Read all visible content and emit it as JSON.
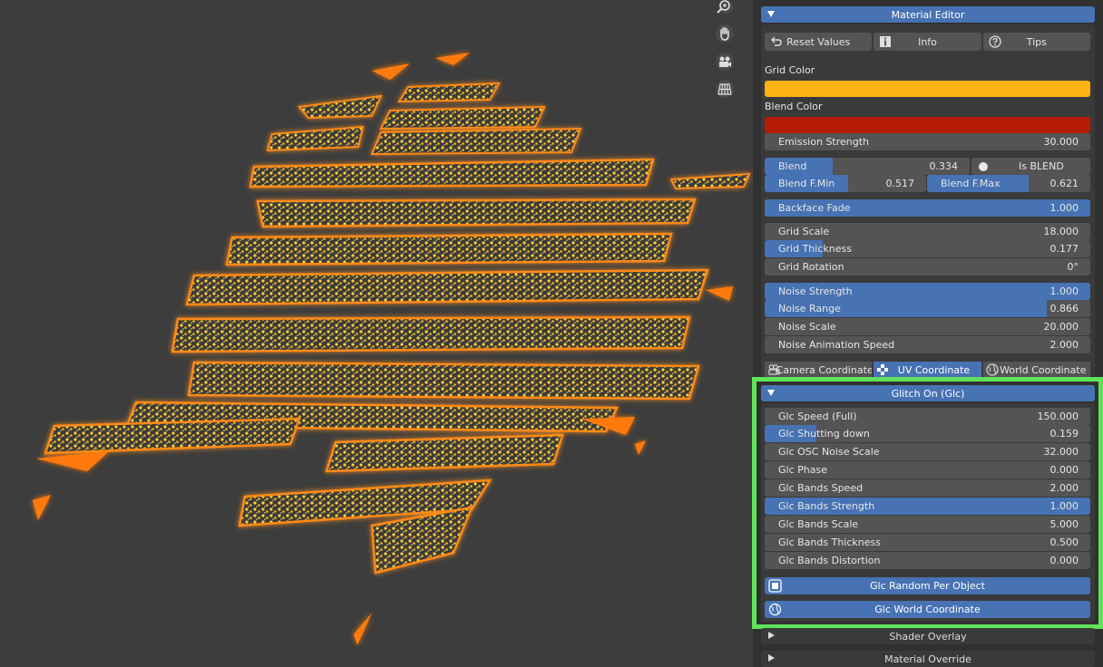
{
  "viewport_tools": [
    {
      "icon": "zoom-icon"
    },
    {
      "icon": "hand-pan-icon"
    },
    {
      "icon": "camera-icon"
    },
    {
      "icon": "grid-perspective-icon"
    }
  ],
  "material_editor": {
    "title": "Material Editor",
    "buttons": {
      "reset": "Reset Values",
      "info": "Info",
      "tips": "Tips"
    },
    "grid_color_label": "Grid Color",
    "grid_color": "#fdb213",
    "blend_color_label": "Blend Color",
    "blend_color": "#b51c06",
    "emission": {
      "name": "Emission Strength",
      "value": "30.000"
    },
    "blend": {
      "name": "Blend",
      "value": "0.334",
      "fraction": 0.334
    },
    "is_blend": "Is BLEND",
    "blend_fmin": {
      "name": "Blend F.Min",
      "value": "0.517",
      "fraction": 0.517
    },
    "blend_fmax": {
      "name": "Blend F.Max",
      "value": "0.621",
      "fraction": 0.621
    },
    "backface_fade": {
      "name": "Backface Fade",
      "value": "1.000",
      "fraction": 1.0
    },
    "grid_scale": {
      "name": "Grid Scale",
      "value": "18.000"
    },
    "grid_thickness": {
      "name": "Grid Thickness",
      "value": "0.177",
      "fraction": 0.177
    },
    "grid_rotation": {
      "name": "Grid Rotation",
      "value": "0°"
    },
    "noise_strength": {
      "name": "Noise Strength",
      "value": "1.000",
      "fraction": 1.0
    },
    "noise_range": {
      "name": "Noise Range",
      "value": "0.866",
      "fraction": 0.866
    },
    "noise_scale": {
      "name": "Noise Scale",
      "value": "20.000"
    },
    "noise_anim": {
      "name": "Noise Animation Speed",
      "value": "2.000"
    },
    "coord_tabs": {
      "camera": "Camera Coordinate",
      "uv": "UV Coordinate",
      "world": "World Coordinate"
    }
  },
  "glitch": {
    "title": "Glitch On (Glc)",
    "fields": [
      {
        "name": "Glc Speed (Full)",
        "value": "150.000",
        "fraction": 0
      },
      {
        "name": "Glc Shutting down",
        "value": "0.159",
        "fraction": 0.159
      },
      {
        "name": "Glc OSC Noise Scale",
        "value": "32.000",
        "fraction": 0
      },
      {
        "name": "Glc Phase",
        "value": "0.000",
        "fraction": 0
      },
      {
        "name": "Glc Bands Speed",
        "value": "2.000",
        "fraction": 0
      },
      {
        "name": "Glc Bands Strength",
        "value": "1.000",
        "fraction": 1.0
      },
      {
        "name": "Glc Bands Scale",
        "value": "5.000",
        "fraction": 0
      },
      {
        "name": "Glc Bands Thickness",
        "value": "0.500",
        "fraction": 0
      },
      {
        "name": "Glc Bands Distortion",
        "value": "0.000",
        "fraction": 0
      }
    ],
    "random_per_object": "Glc Random Per Object",
    "world_coordinate": "Glc World Coordinate"
  },
  "collapsed_panels": {
    "shader_overlay": "Shader Overlay",
    "material_override": "Material Override"
  },
  "colors": {
    "accent": "#4772b3",
    "highlight": "#5fe35a",
    "field": "#545454",
    "panel": "#303030"
  }
}
